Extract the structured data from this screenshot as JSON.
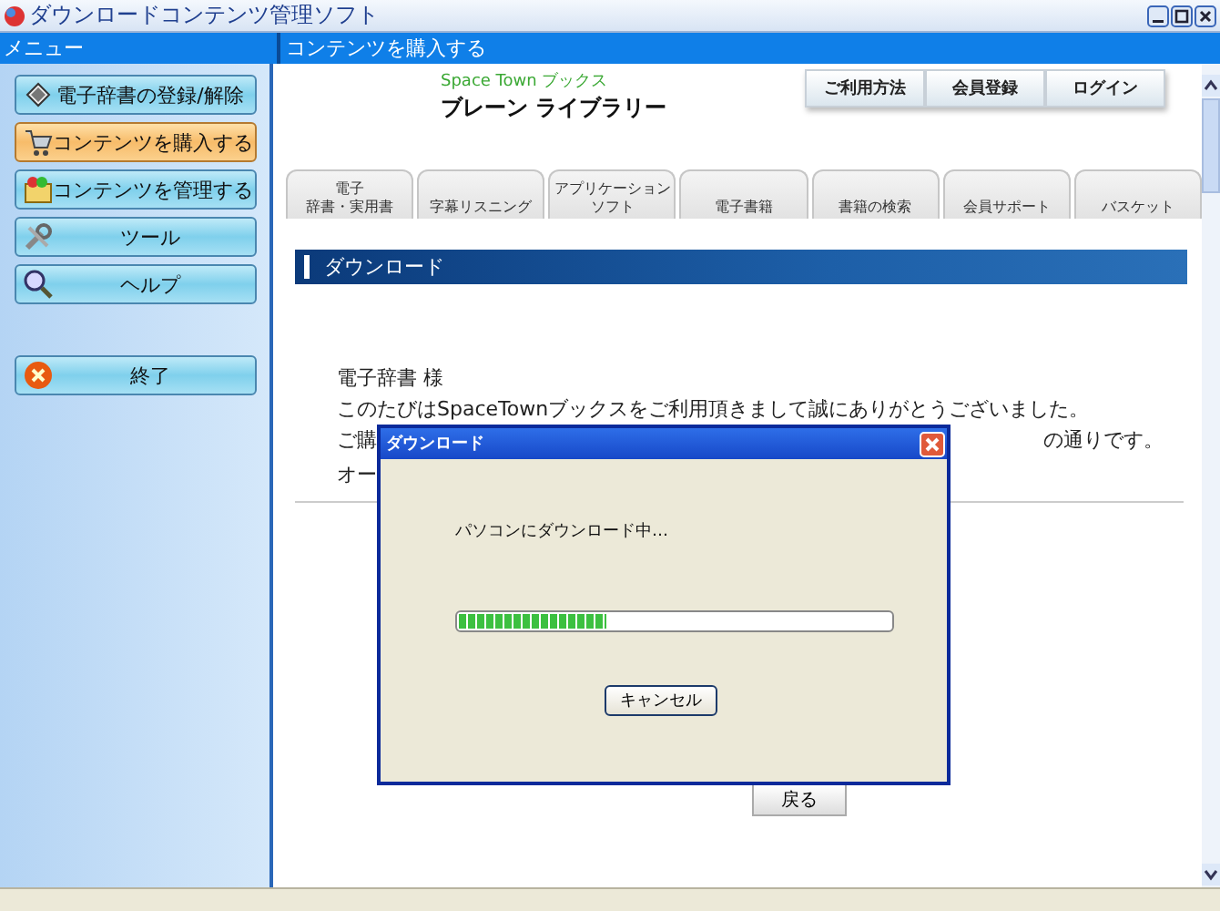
{
  "window": {
    "title": "ダウンロードコンテンツ管理ソフト"
  },
  "sidebar": {
    "header": "メニュー",
    "items": [
      {
        "label": "電子辞書の登録/解除",
        "selected": false
      },
      {
        "label": "コンテンツを購入する",
        "selected": true
      },
      {
        "label": "コンテンツを管理する",
        "selected": false
      },
      {
        "label": "ツール",
        "selected": false
      },
      {
        "label": "ヘルプ",
        "selected": false
      }
    ],
    "exit_button": "終了"
  },
  "content": {
    "header": "コンテンツを購入する",
    "brand_sub": "Space Town ブックス",
    "brand": "ブレーン ライブラリー",
    "top_links": [
      "ご利用方法",
      "会員登録",
      "ログイン"
    ],
    "tabs": [
      {
        "lines": [
          "電子",
          "辞書・実用書"
        ]
      },
      {
        "lines": [
          "字幕リスニング"
        ]
      },
      {
        "lines": [
          "アプリケーション",
          "ソフト"
        ]
      },
      {
        "lines": [
          "電子書籍"
        ]
      },
      {
        "lines": [
          "書籍の検索"
        ]
      },
      {
        "lines": [
          "会員サポート"
        ]
      },
      {
        "lines": [
          "バスケット"
        ]
      }
    ],
    "section_title": "ダウンロード",
    "greeting": "電子辞書 様",
    "message": "このたびはSpaceTownブックスをご利用頂きまして誠にありがとうございました。",
    "line3_left": "ご購",
    "line3_right": "の通りです。",
    "line4": "オー",
    "back_button": "戻る"
  },
  "dialog": {
    "title": "ダウンロード",
    "message": "パソコンにダウンロード中…",
    "level": 0.34,
    "cancel_button": "キャンセル"
  }
}
